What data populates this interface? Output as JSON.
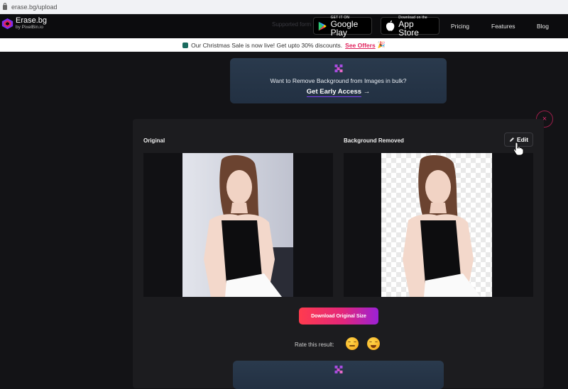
{
  "browser": {
    "url": "erase.bg/upload"
  },
  "header": {
    "logo_title": "Erase.bg",
    "logo_subtitle": "by PixelBin.io",
    "supported_formats_text": "Supported form",
    "google_play": {
      "small": "GET IT ON",
      "big": "Google Play"
    },
    "app_store": {
      "small": "Download on the",
      "big": "App Store"
    },
    "nav": [
      {
        "label": "Pricing"
      },
      {
        "label": "Features"
      },
      {
        "label": "Blog"
      }
    ]
  },
  "promo_banner": {
    "text": "Our Christmas Sale is now live! Get upto 30% discounts.",
    "link": "See Offers",
    "emoji": "🎉"
  },
  "bulk_card": {
    "text": "Want to Remove Background from Images in bulk?",
    "cta": "Get Early Access",
    "cta_arrow": "→"
  },
  "result": {
    "original_label": "Original",
    "removed_label": "Background Removed",
    "edit_label": "Edit",
    "edit_icon": "pencil-icon",
    "download_label": "Download Original Size",
    "rate_label": "Rate this result:",
    "close_icon": "×"
  },
  "colors": {
    "accent_pink": "#e0245e",
    "download_gradient_start": "#ff3b4e",
    "download_gradient_end": "#9b21d6",
    "page_bg": "#131316",
    "card_bg": "#1c1c1f"
  }
}
